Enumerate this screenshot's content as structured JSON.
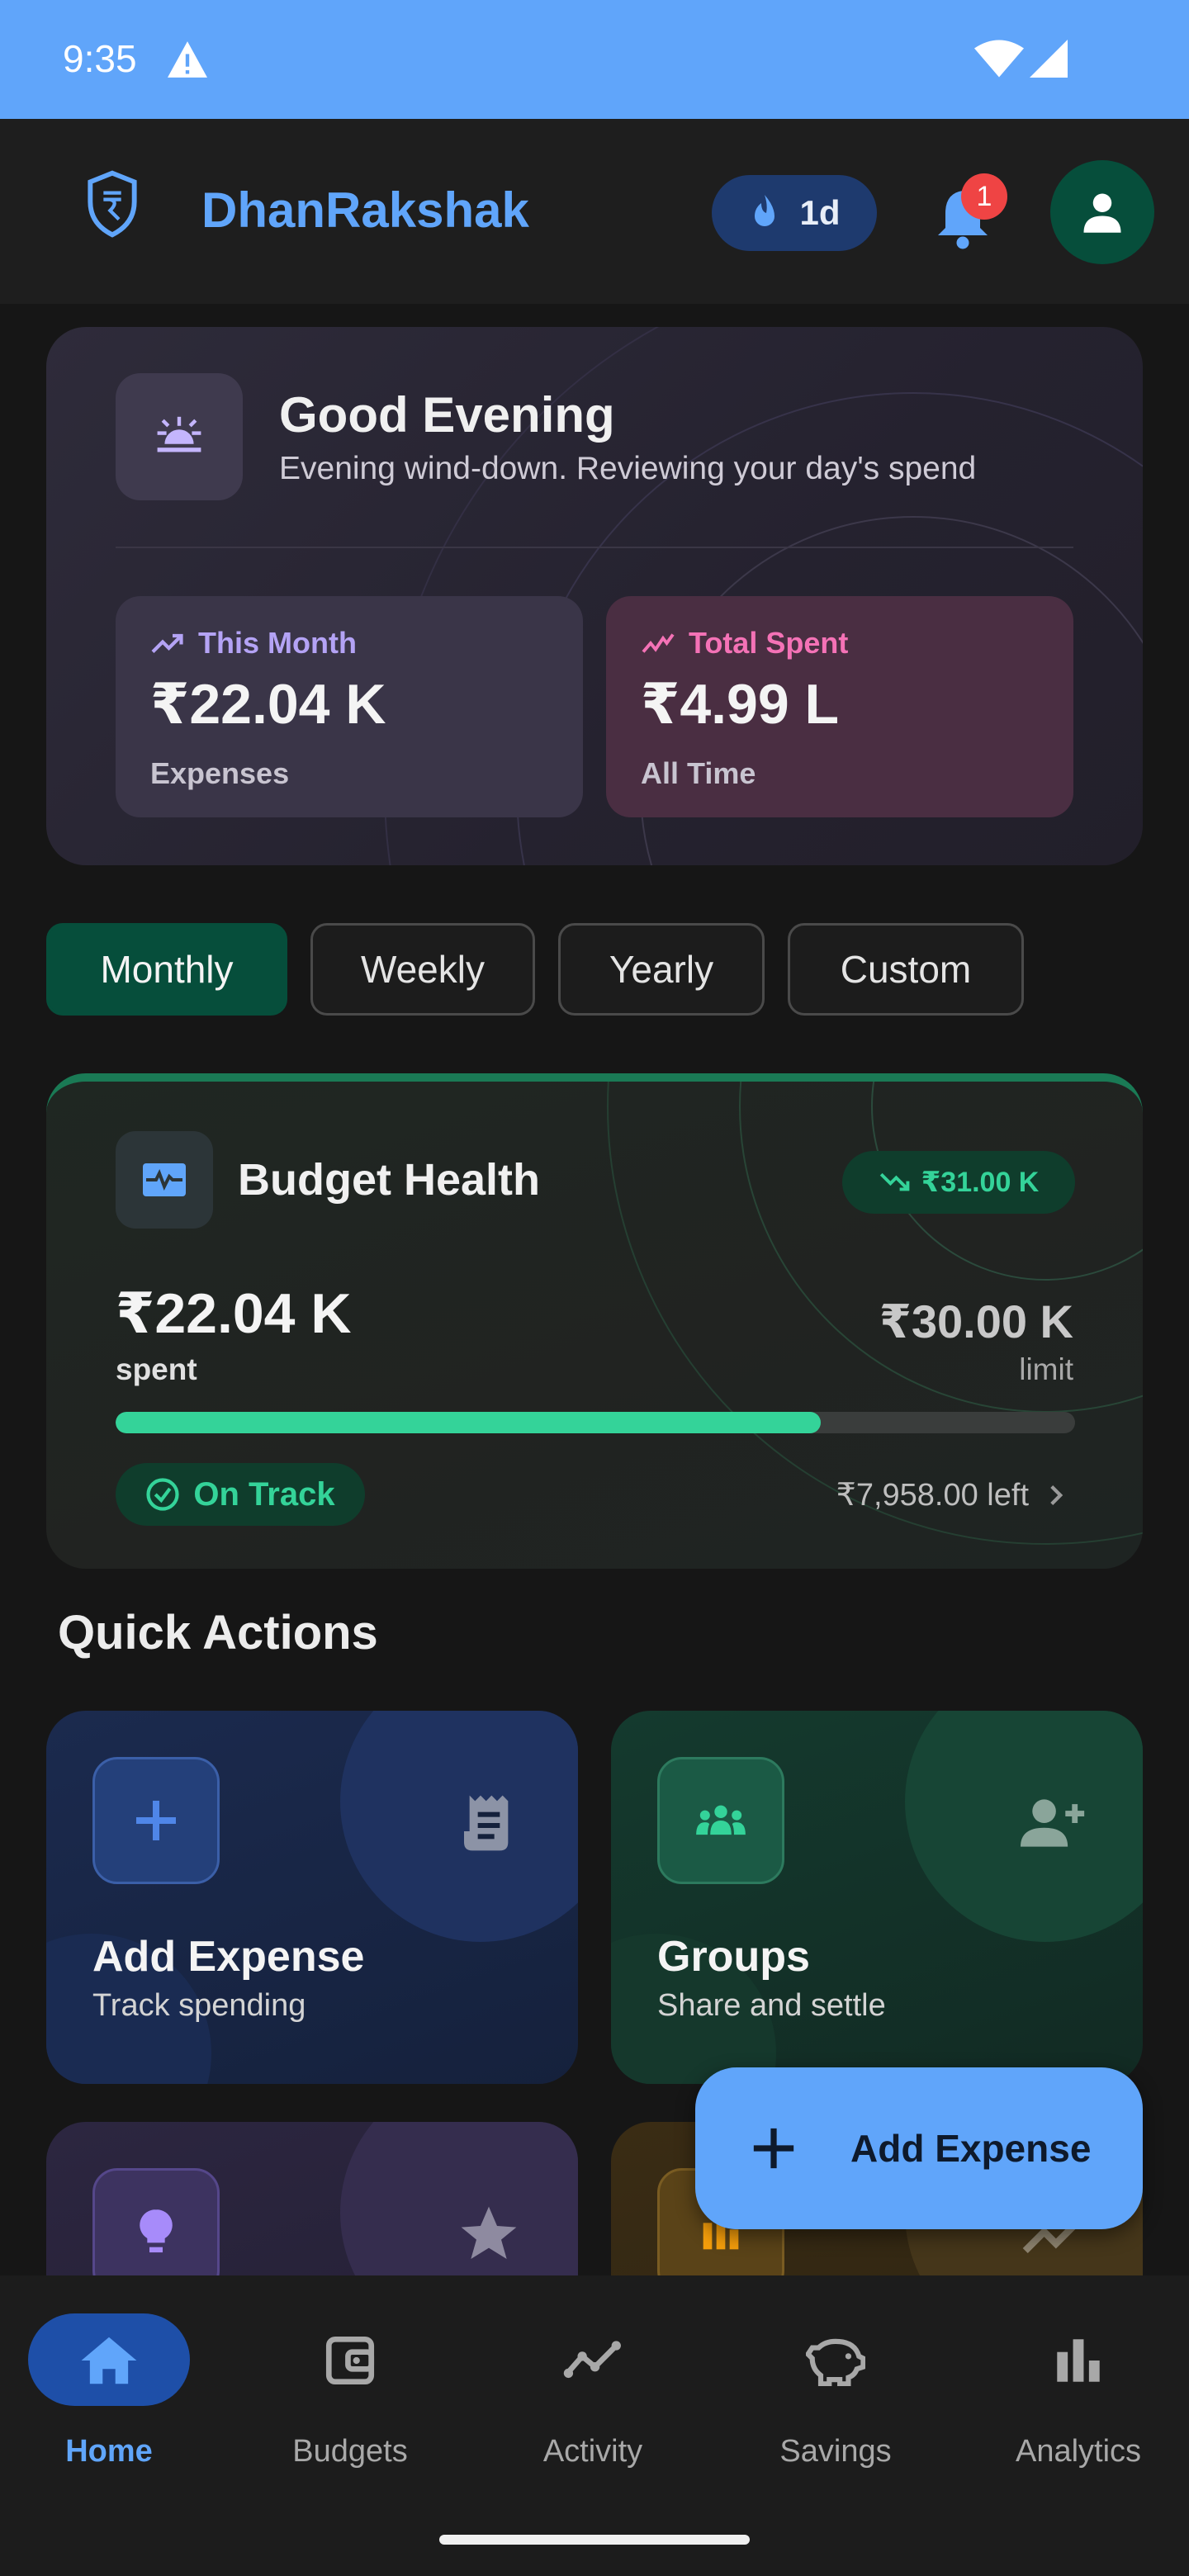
{
  "status_bar": {
    "time": "9:35"
  },
  "app_bar": {
    "title": "DhanRakshak",
    "streak": "1d",
    "notification_count": "1"
  },
  "greeting": {
    "title": "Good Evening",
    "subtitle": "Evening wind-down. Reviewing your day's spend",
    "this_month": {
      "label": "This Month",
      "value": "₹22.04 K",
      "caption": "Expenses"
    },
    "total_spent": {
      "label": "Total Spent",
      "value": "₹4.99 L",
      "caption": "All Time"
    }
  },
  "period_tabs": [
    {
      "label": "Monthly",
      "active": true
    },
    {
      "label": "Weekly",
      "active": false
    },
    {
      "label": "Yearly",
      "active": false
    },
    {
      "label": "Custom",
      "active": false
    }
  ],
  "budget_health": {
    "title": "Budget Health",
    "trend_chip": "₹31.00 K",
    "spent_value": "₹22.04 K",
    "spent_label": "spent",
    "limit_value": "₹30.00 K",
    "limit_label": "limit",
    "progress_fraction": 0.7347,
    "status": "On Track",
    "remaining": "₹7,958.00 left"
  },
  "quick_actions": {
    "heading": "Quick Actions",
    "items": [
      {
        "title": "Add Expense",
        "subtitle": "Track spending",
        "icon": "plus-icon",
        "side_icon": "receipt-icon"
      },
      {
        "title": "Groups",
        "subtitle": "Share and settle",
        "icon": "groups-icon",
        "side_icon": "add-person-icon"
      },
      {
        "title": "",
        "subtitle": "",
        "icon": "lightbulb-icon",
        "side_icon": "star-icon"
      },
      {
        "title": "",
        "subtitle": "",
        "icon": "bar-chart-icon",
        "side_icon": "trend-icon"
      }
    ]
  },
  "fab": {
    "label": "Add Expense"
  },
  "bottom_nav": [
    {
      "label": "Home",
      "active": true
    },
    {
      "label": "Budgets",
      "active": false
    },
    {
      "label": "Activity",
      "active": false
    },
    {
      "label": "Savings",
      "active": false
    },
    {
      "label": "Analytics",
      "active": false
    }
  ],
  "colors": {
    "accent": "#60A5FA",
    "success": "#34D399",
    "brand_green": "#064E3B",
    "alert": "#EF4444"
  }
}
